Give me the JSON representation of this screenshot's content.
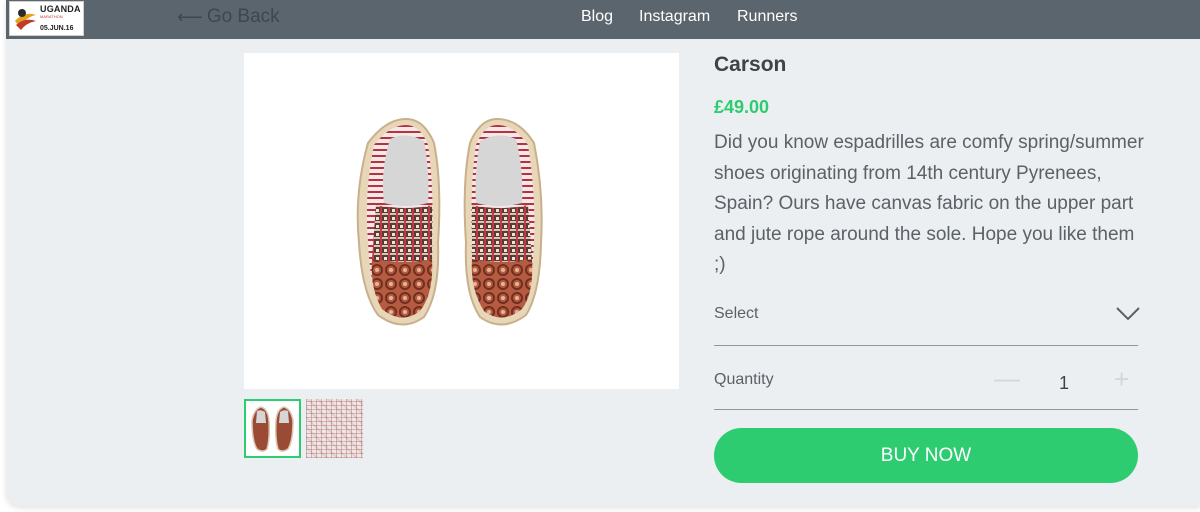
{
  "logo": {
    "line1": "UGANDA",
    "line2": "MARATHON",
    "line3": "05.JUN.16"
  },
  "header": {
    "back_label": "Go Back",
    "nav": [
      {
        "label": "Blog"
      },
      {
        "label": "Instagram"
      },
      {
        "label": "Runners"
      }
    ]
  },
  "product": {
    "name": "Carson",
    "price": "£49.00",
    "description": "Did you know espadrilles are comfy spring/summer shoes originating from 14th century Pyrenees, Spain? Ours have canvas fabric on the upper part and jute rope around the sole. Hope you like them ;)",
    "select_label": "Select",
    "quantity_label": "Quantity",
    "quantity_value": "1",
    "minus_symbol": "—",
    "plus_symbol": "+",
    "buy_label": "BUY NOW"
  },
  "colors": {
    "accent": "#2ecc71",
    "header_bg": "#5b656d",
    "page_bg": "#eceff1"
  },
  "icons": {
    "back": "arrow-left-icon",
    "select": "chevron-down-icon"
  }
}
